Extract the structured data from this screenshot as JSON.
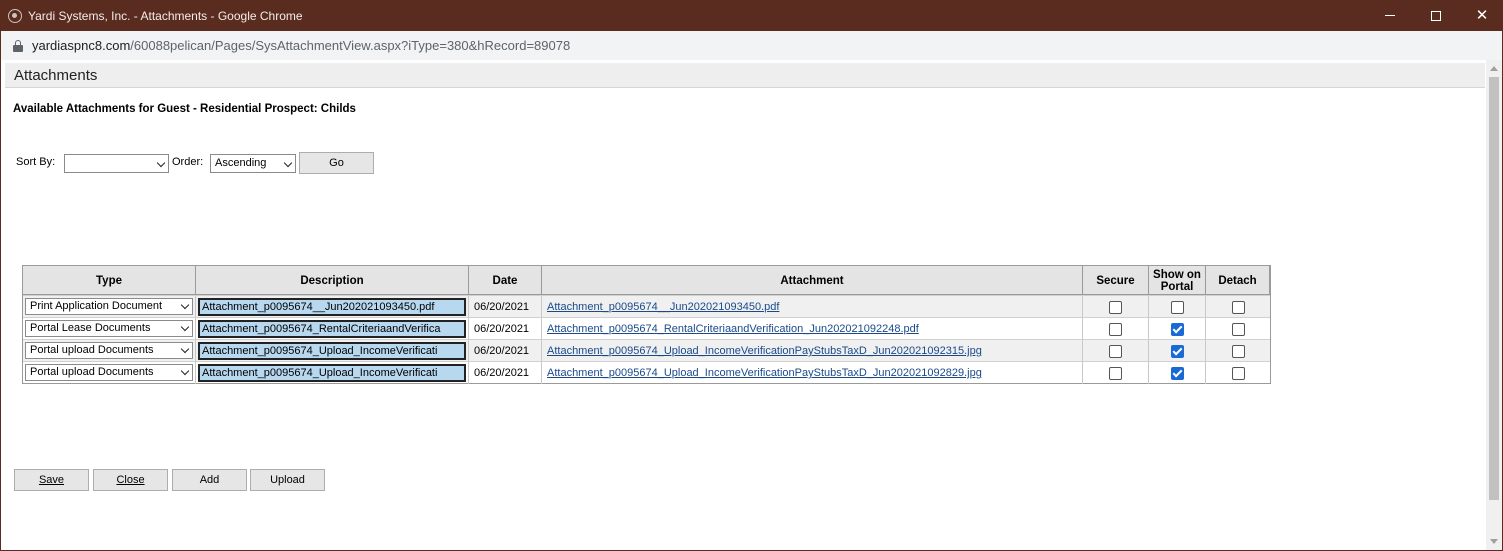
{
  "window": {
    "title": "Yardi Systems, Inc. - Attachments - Google Chrome",
    "url_host": "yardiaspnc8.com",
    "url_path": "/60088pelican/Pages/SysAttachmentView.aspx?iType=380&hRecord=89078"
  },
  "page": {
    "header": "Attachments",
    "subtitle": "Available Attachments for Guest - Residential Prospect: Childs"
  },
  "sort": {
    "sort_by_label": "Sort By:",
    "sort_by_value": "",
    "order_label": "Order:",
    "order_value": "Ascending",
    "go_label": "Go"
  },
  "table": {
    "headers": [
      "Type",
      "Description",
      "Date",
      "Attachment",
      "Secure",
      "Show on Portal",
      "Detach"
    ],
    "rows": [
      {
        "type": "Print Application Document",
        "description": "Attachment_p0095674__Jun202021093450.pdf",
        "date": "06/20/2021",
        "attachment": "Attachment_p0095674__Jun202021093450.pdf",
        "secure": false,
        "show_on_portal": false,
        "detach": false
      },
      {
        "type": "Portal Lease Documents",
        "description": "Attachment_p0095674_RentalCriteriaandVerifica",
        "date": "06/20/2021",
        "attachment": "Attachment_p0095674_RentalCriteriaandVerification_Jun202021092248.pdf",
        "secure": false,
        "show_on_portal": true,
        "detach": false
      },
      {
        "type": "Portal upload Documents",
        "description": "Attachment_p0095674_Upload_IncomeVerificati",
        "date": "06/20/2021",
        "attachment": "Attachment_p0095674_Upload_IncomeVerificationPayStubsTaxD_Jun202021092315.jpg",
        "secure": false,
        "show_on_portal": true,
        "detach": false
      },
      {
        "type": "Portal upload Documents",
        "description": "Attachment_p0095674_Upload_IncomeVerificati",
        "date": "06/20/2021",
        "attachment": "Attachment_p0095674_Upload_IncomeVerificationPayStubsTaxD_Jun202021092829.jpg",
        "secure": false,
        "show_on_portal": true,
        "detach": false
      }
    ]
  },
  "buttons": {
    "save": "Save",
    "close": "Close",
    "add": "Add",
    "upload": "Upload"
  },
  "colors": {
    "titlebar": "#5a2c20",
    "link": "#1a4a8a",
    "checkbox_checked": "#1a6ad6"
  }
}
